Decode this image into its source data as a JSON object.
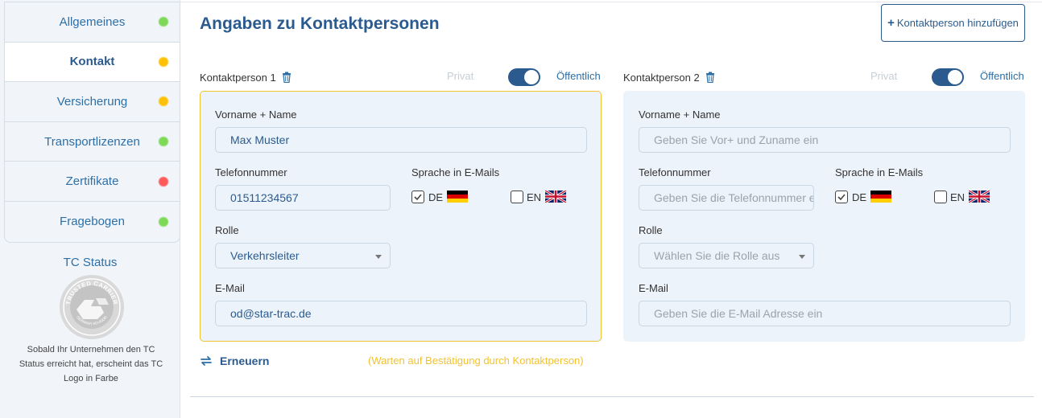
{
  "sidebar": {
    "items": [
      {
        "label": "Allgemeines",
        "status_color": "#7ed957",
        "active": false
      },
      {
        "label": "Kontakt",
        "status_color": "#ffc107",
        "active": true
      },
      {
        "label": "Versicherung",
        "status_color": "#ffc107",
        "active": false
      },
      {
        "label": "Transportlizenzen",
        "status_color": "#7ed957",
        "active": false
      },
      {
        "label": "Zertifikate",
        "status_color": "#ff5a5a",
        "active": false
      },
      {
        "label": "Fragebogen",
        "status_color": "#7ed957",
        "active": false
      }
    ],
    "tc_status_title": "TC Status",
    "tc_logo_text": "TRUSTED CARRIER",
    "tc_logo_subtext": "GERMANY ADVISOR",
    "tc_status_text": "Sobald Ihr Unternehmen den TC Status erreicht hat, erscheint das TC Logo in Farbe"
  },
  "main": {
    "title": "Angaben zu Kontaktpersonen",
    "add_button_label": "Kontaktperson hinzufügen",
    "contacts": [
      {
        "heading": "Kontaktperson 1",
        "private_label": "Privat",
        "public_label": "Öffentlich",
        "name_label": "Vorname + Name",
        "name_value": "Max Muster",
        "phone_label": "Telefonnummer",
        "phone_value": "01511234567",
        "lang_label": "Sprache in E-Mails",
        "lang_de": "DE",
        "lang_en": "EN",
        "role_label": "Rolle",
        "role_value": "Verkehrsleiter",
        "email_label": "E-Mail",
        "email_value": "od@star-trac.de"
      },
      {
        "heading": "Kontaktperson 2",
        "private_label": "Privat",
        "public_label": "Öffentlich",
        "name_label": "Vorname + Name",
        "name_placeholder": "Geben Sie Vor+ und Zuname ein",
        "phone_label": "Telefonnummer",
        "phone_placeholder": "Geben Sie die Telefonnummer ein",
        "lang_label": "Sprache in E-Mails",
        "lang_de": "DE",
        "lang_en": "EN",
        "role_label": "Rolle",
        "role_placeholder": "Wählen Sie die Rolle aus",
        "email_label": "E-Mail",
        "email_placeholder": "Geben Sie die E-Mail Adresse ein"
      }
    ],
    "renew_label": "Erneuern",
    "waiting_text": "(Warten auf Bestätigung durch Kontaktperson)"
  },
  "colors": {
    "accent": "#2b5b8e",
    "warning": "#f1c232",
    "card_bg": "#edf3fa"
  }
}
